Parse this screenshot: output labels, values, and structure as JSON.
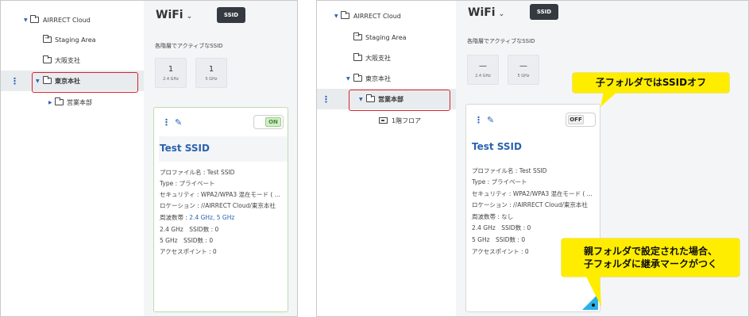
{
  "left": {
    "tree": {
      "root": "AIRRECT Cloud",
      "staging": "Staging Area",
      "osaka": "大阪支社",
      "tokyo": "東京本社",
      "sales": "営業本部"
    },
    "header": {
      "title": "WiFi",
      "ssid_button": "SSID"
    },
    "region_label": "各階層でアクティブなSSID",
    "freq": [
      {
        "count": "1",
        "band": "2.4 GHz"
      },
      {
        "count": "1",
        "band": "5 GHz"
      }
    ],
    "card": {
      "toggle": "ON",
      "title": "Test SSID",
      "lines": {
        "profile": "プロファイル名 : Test SSID",
        "type": "Type : プライベート",
        "security": "セキュリティ : WPA2/WPA3 混在モード ( ...",
        "location": "ロケーション : //AIRRECT Cloud/東京本社",
        "freq_prefix": "周波数帯 : ",
        "freq_value": "2.4 GHz, 5 GHz",
        "ssid24": "2.4 GHz　SSID数 : 0",
        "ssid5": "5 GHz　SSID数 : 0",
        "ap": "アクセスポイント : 0"
      }
    }
  },
  "right": {
    "tree": {
      "root": "AIRRECT Cloud",
      "staging": "Staging Area",
      "osaka": "大阪支社",
      "tokyo": "東京本社",
      "sales": "営業本部",
      "floor": "1階フロア"
    },
    "header": {
      "title": "WiFi",
      "ssid_button": "SSID"
    },
    "region_label": "各階層でアクティブなSSID",
    "freq": [
      {
        "count": "—",
        "band": "2.4 GHz"
      },
      {
        "count": "—",
        "band": "5 GHz"
      }
    ],
    "card": {
      "toggle": "OFF",
      "title": "Test SSID",
      "lines": {
        "profile": "プロファイル名 : Test SSID",
        "type": "Type : プライベート",
        "security": "セキュリティ : WPA2/WPA3 混在モード ( ...",
        "location": "ロケーション : //AIRRECT Cloud/東京本社",
        "freq": "周波数帯 : なし",
        "ssid24": "2.4 GHz　SSID数 : 0",
        "ssid5": "5 GHz　SSID数 : 0",
        "ap": "アクセスポイント : 0"
      }
    },
    "callouts": {
      "top": "子フォルダではSSIDオフ",
      "bottom_line1": "親フォルダで設定された場合、",
      "bottom_line2": "子フォルダに継承マークがつく"
    }
  },
  "colors": {
    "accent_blue": "#2a62b0",
    "highlight_red": "#d6232b",
    "callout_yellow": "#ffed00",
    "on_green": "#3e8e2a",
    "inherit_mark": "#2bb0ea"
  },
  "icons": [
    "folder-icon",
    "caret-down-icon",
    "caret-right-icon",
    "kebab-menu-icon",
    "pencil-icon",
    "chevron-down-icon",
    "device-icon",
    "inherit-mark-icon"
  ]
}
